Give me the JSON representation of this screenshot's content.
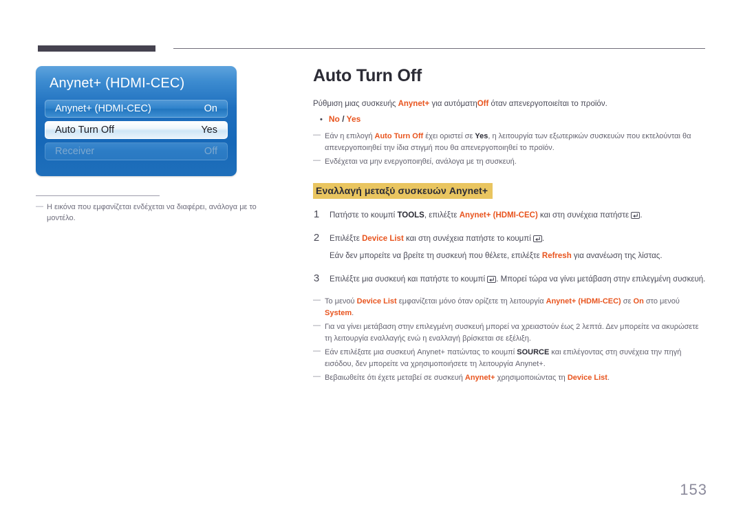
{
  "colors": {
    "accent_orange": "#e8541e",
    "highlight_yellow": "#e9c560",
    "rule_dark": "#45424f",
    "osd_blue": "#1e6fbe",
    "page_number": "#8b8a9b"
  },
  "osd": {
    "title": "Anynet+ (HDMI-CEC)",
    "rows": [
      {
        "label": "Anynet+ (HDMI-CEC)",
        "value": "On",
        "state": "normal"
      },
      {
        "label": "Auto Turn Off",
        "value": "Yes",
        "state": "selected"
      },
      {
        "label": "Receiver",
        "value": "Off",
        "state": "disabled"
      }
    ]
  },
  "left_note": {
    "dash": "―",
    "text": "Η εικόνα που εμφανίζεται ενδέχεται να διαφέρει, ανάλογα με το μοντέλο."
  },
  "main": {
    "title": "Auto Turn Off",
    "intro": {
      "part1": "Ρύθμιση μιας συσκευής ",
      "term1": "Anynet+",
      "part2": " για αυτόματη",
      "term2": "Off",
      "part3": " όταν απενεργοποιείται το προϊόν."
    },
    "options_bullet": {
      "dot": "•",
      "option_a": "No",
      "separator": " / ",
      "option_b": "Yes"
    },
    "notes_top": [
      {
        "dash": "―",
        "segments": [
          {
            "text": "Εάν η επιλογή ",
            "style": "plain"
          },
          {
            "text": "Auto Turn Off",
            "style": "orange"
          },
          {
            "text": " έχει οριστεί σε ",
            "style": "plain"
          },
          {
            "text": "Yes",
            "style": "black-bold"
          },
          {
            "text": ", η λειτουργία των εξωτερικών συσκευών που εκτελούνται θα απενεργοποιηθεί την ίδια στιγμή που θα απενεργοποιηθεί το προϊόν.",
            "style": "plain"
          }
        ]
      },
      {
        "dash": "―",
        "segments": [
          {
            "text": "Ενδέχεται να μην ενεργοποιηθεί, ανάλογα με τη συσκευή.",
            "style": "plain"
          }
        ]
      }
    ],
    "section_heading": "Εναλλαγή μεταξύ συσκευών Anynet+",
    "steps": [
      {
        "number": "1",
        "segments": [
          {
            "text": "Πατήστε το κουμπί ",
            "style": "plain"
          },
          {
            "text": "TOOLS",
            "style": "black-bold"
          },
          {
            "text": ", επιλέξτε ",
            "style": "plain"
          },
          {
            "text": "Anynet+ (HDMI-CEC)",
            "style": "orange"
          },
          {
            "text": " και στη συνέχεια πατήστε ",
            "style": "plain"
          },
          {
            "text": "",
            "style": "enter-key"
          },
          {
            "text": ".",
            "style": "plain"
          }
        ]
      },
      {
        "number": "2",
        "segments": [
          {
            "text": "Επιλέξτε ",
            "style": "plain"
          },
          {
            "text": "Device List",
            "style": "orange"
          },
          {
            "text": " και στη συνέχεια πατήστε το κουμπί ",
            "style": "plain"
          },
          {
            "text": "",
            "style": "enter-key"
          },
          {
            "text": ".",
            "style": "plain"
          }
        ],
        "substep": [
          {
            "text": "Εάν δεν μπορείτε να βρείτε τη συσκευή που θέλετε, επιλέξτε ",
            "style": "plain"
          },
          {
            "text": "Refresh",
            "style": "orange"
          },
          {
            "text": " για ανανέωση της λίστας.",
            "style": "plain"
          }
        ]
      },
      {
        "number": "3",
        "segments": [
          {
            "text": "Επιλέξτε μια συσκευή και πατήστε το κουμπί ",
            "style": "plain"
          },
          {
            "text": "",
            "style": "enter-key"
          },
          {
            "text": ". Μπορεί τώρα να γίνει μετάβαση στην επιλεγμένη συσκευή.",
            "style": "plain"
          }
        ]
      }
    ],
    "notes_bottom": [
      {
        "dash": "―",
        "segments": [
          {
            "text": "Το μενού ",
            "style": "plain"
          },
          {
            "text": "Device List",
            "style": "orange"
          },
          {
            "text": " εμφανίζεται μόνο όταν ορίζετε τη λειτουργία ",
            "style": "plain"
          },
          {
            "text": "Anynet+ (HDMI-CEC)",
            "style": "orange"
          },
          {
            "text": " σε ",
            "style": "plain"
          },
          {
            "text": "On",
            "style": "orange"
          },
          {
            "text": " στο μενού ",
            "style": "plain"
          },
          {
            "text": "System",
            "style": "orange"
          },
          {
            "text": ".",
            "style": "plain"
          }
        ]
      },
      {
        "dash": "―",
        "segments": [
          {
            "text": "Για να γίνει μετάβαση στην επιλεγμένη συσκευή μπορεί να χρειαστούν έως 2 λεπτά. Δεν μπορείτε να ακυρώσετε τη λειτουργία εναλλαγής ενώ η εναλλαγή βρίσκεται σε εξέλιξη.",
            "style": "plain"
          }
        ]
      },
      {
        "dash": "―",
        "segments": [
          {
            "text": "Εάν επιλέξατε μια συσκευή Anynet+ πατώντας το κουμπί ",
            "style": "plain"
          },
          {
            "text": "SOURCE",
            "style": "black-bold"
          },
          {
            "text": " και επιλέγοντας στη συνέχεια την πηγή εισόδου, δεν μπορείτε να χρησιμοποιήσετε τη λειτουργία Anynet+.",
            "style": "plain"
          }
        ]
      },
      {
        "dash": "―",
        "segments": [
          {
            "text": "Βεβαιωθείτε ότι έχετε μεταβεί σε συσκευή ",
            "style": "plain"
          },
          {
            "text": "Anynet+",
            "style": "orange"
          },
          {
            "text": " χρησιμοποιώντας τη ",
            "style": "plain"
          },
          {
            "text": "Device List",
            "style": "orange"
          },
          {
            "text": ".",
            "style": "plain"
          }
        ]
      }
    ]
  },
  "footer": {
    "page_number": "153"
  }
}
